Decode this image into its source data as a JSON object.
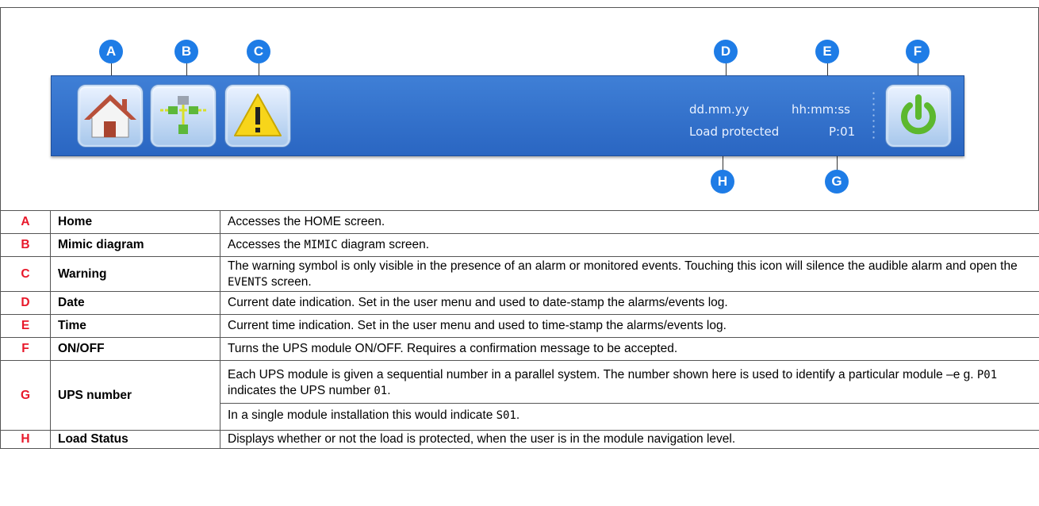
{
  "callouts": {
    "a": "A",
    "b": "B",
    "c": "C",
    "d": "D",
    "e": "E",
    "f": "F",
    "g": "G",
    "h": "H"
  },
  "status_bar": {
    "date": "dd.mm.yy",
    "time": "hh:mm:ss",
    "load_status": "Load protected",
    "ups_number": "P:01"
  },
  "icons": {
    "home": "home-icon",
    "mimic": "mimic-diagram-icon",
    "warning": "warning-icon",
    "power": "power-icon"
  },
  "colors": {
    "callout": "#1e7ce6",
    "bar": "#3272cc",
    "letter": "#e8182a",
    "power_green": "#5cb82e",
    "warning_yellow": "#f7d51a"
  },
  "rows": [
    {
      "letter": "A",
      "name": "Home",
      "desc": [
        [
          "Accesses the HOME screen."
        ]
      ]
    },
    {
      "letter": "B",
      "name": "Mimic diagram",
      "desc": [
        [
          "Accesses the ",
          {
            "code": "MIMIC"
          },
          " diagram screen."
        ]
      ]
    },
    {
      "letter": "C",
      "name": "Warning",
      "desc": [
        [
          "The warning symbol is only visible in the presence of an alarm or monitored events. Touching this icon will silence the audible alarm and open the ",
          {
            "code": "EVENTS"
          },
          " screen."
        ]
      ]
    },
    {
      "letter": "D",
      "name": "Date",
      "desc": [
        [
          "Current date indication. Set in the user menu and used to date-stamp the alarms/events log."
        ]
      ]
    },
    {
      "letter": "E",
      "name": "Time",
      "desc": [
        [
          "Current time indication. Set in the user menu and used to time-stamp the alarms/events log."
        ]
      ]
    },
    {
      "letter": "F",
      "name": "ON/OFF",
      "desc": [
        [
          "Turns the UPS module ON/OFF. Requires a confirmation message to be accepted."
        ]
      ]
    },
    {
      "letter": "G",
      "name": "UPS number",
      "desc": [
        [
          "Each UPS module is given a sequential number in a parallel system. The number shown here is used to identify a particular module –e g. ",
          {
            "code": "P01"
          },
          " indicates the UPS number ",
          {
            "code": "01"
          },
          "."
        ],
        [
          "In a single module installation this would indicate ",
          {
            "code": "S01"
          },
          "."
        ]
      ]
    },
    {
      "letter": "H",
      "name": "Load Status",
      "desc": [
        [
          "Displays whether or not the load is protected, when the user is in the module navigation level."
        ]
      ]
    }
  ]
}
